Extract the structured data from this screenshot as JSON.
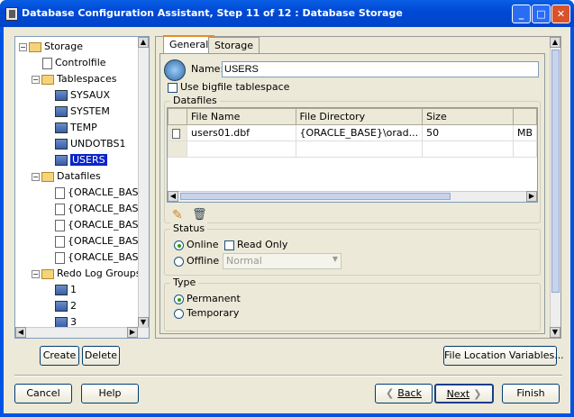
{
  "window": {
    "title": "Database Configuration Assistant, Step 11 of 12 : Database Storage"
  },
  "tree": {
    "storage": "Storage",
    "controlfile": "Controlfile",
    "tablespaces": "Tablespaces",
    "ts_items": [
      "SYSAUX",
      "SYSTEM",
      "TEMP",
      "UNDOTBS1",
      "USERS"
    ],
    "datafiles": "Datafiles",
    "df_items": [
      "{ORACLE_BASE",
      "{ORACLE_BASE",
      "{ORACLE_BASE",
      "{ORACLE_BASE",
      "{ORACLE_BASE"
    ],
    "redo": "Redo Log Groups",
    "redo_items": [
      "1",
      "2",
      "3"
    ]
  },
  "tabs": {
    "general": "General",
    "storage": "Storage"
  },
  "form": {
    "name_label": "Name:",
    "name_value": "USERS",
    "bigfile_label": "Use bigfile tablespace",
    "datafiles_title": "Datafiles",
    "columns": [
      "File Name",
      "File Directory",
      "Size"
    ],
    "row": {
      "file": "users01.dbf",
      "dir": "{ORACLE_BASE}\\orad...",
      "size": "50",
      "unit": "MB"
    },
    "status_title": "Status",
    "online": "Online",
    "readonly": "Read Only",
    "offline": "Offline",
    "offline_select": "Normal",
    "type_title": "Type",
    "permanent": "Permanent",
    "temporary": "Temporary"
  },
  "buttons": {
    "create": "Create",
    "delete": "Delete",
    "file_location": "File Location Variables...",
    "cancel": "Cancel",
    "help": "Help",
    "back": "Back",
    "next": "Next",
    "finish": "Finish"
  }
}
